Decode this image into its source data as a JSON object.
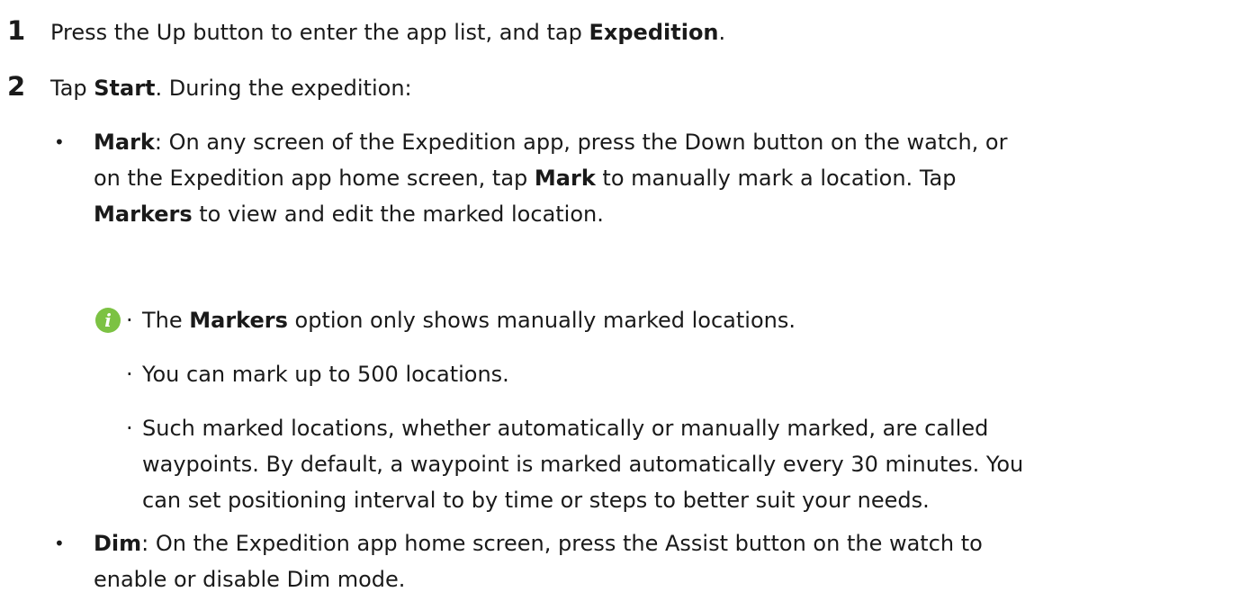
{
  "steps": [
    {
      "number": "1",
      "parts": [
        "Press the Up button to enter the app list, and tap ",
        "Expedition",
        "."
      ]
    },
    {
      "number": "2",
      "parts": [
        "Tap ",
        "Start",
        ". During the expedition:"
      ]
    }
  ],
  "mark_item": {
    "label": "Mark",
    "line1": ": On any screen of the Expedition app, press the Down button on the watch, or",
    "line2a": "on the Expedition app home screen, tap ",
    "line2b": "Mark",
    "line2c": " to manually mark a location. Tap",
    "line3a": "Markers",
    "line3b": " to view and edit the marked location."
  },
  "notes": {
    "icon": "info-icon",
    "note1a": "The ",
    "note1b": "Markers",
    "note1c": " option only shows manually marked locations.",
    "note2": "You can mark up to 500 locations.",
    "note3_line1": "Such marked locations, whether automatically or manually marked, are called",
    "note3_line2": "waypoints. By default, a waypoint is marked automatically every 30 minutes. You",
    "note3_line3": "can set positioning interval to by time or steps to better suit your needs."
  },
  "dim_item": {
    "label": "Dim",
    "line1": ": On the Expedition app home screen, press the Assist button on the watch to",
    "line2": "enable or disable Dim mode."
  },
  "bullet_char": "•",
  "note_bullet_char": "·",
  "colors": {
    "text": "#1a1a1a",
    "note_icon": "#7cc243"
  }
}
